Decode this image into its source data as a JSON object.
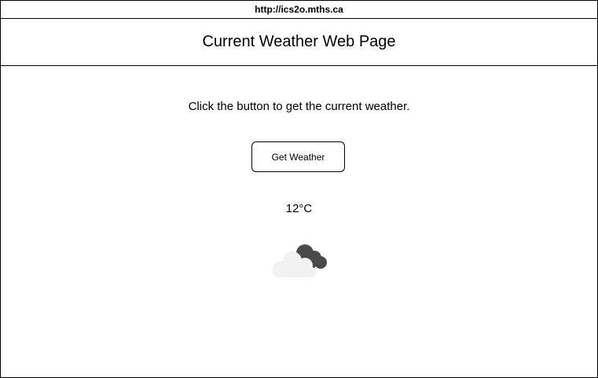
{
  "browser": {
    "url": "http://ics2o.mths.ca"
  },
  "header": {
    "title": "Current Weather Web Page"
  },
  "main": {
    "instruction": "Click the button to get the current weather.",
    "button_label": "Get Weather",
    "temperature": "12°C",
    "weather_icon": "cloudy-icon"
  },
  "colors": {
    "dark_cloud": "#4a4a4a",
    "light_cloud": "#f2f2f2",
    "border": "#000000"
  }
}
